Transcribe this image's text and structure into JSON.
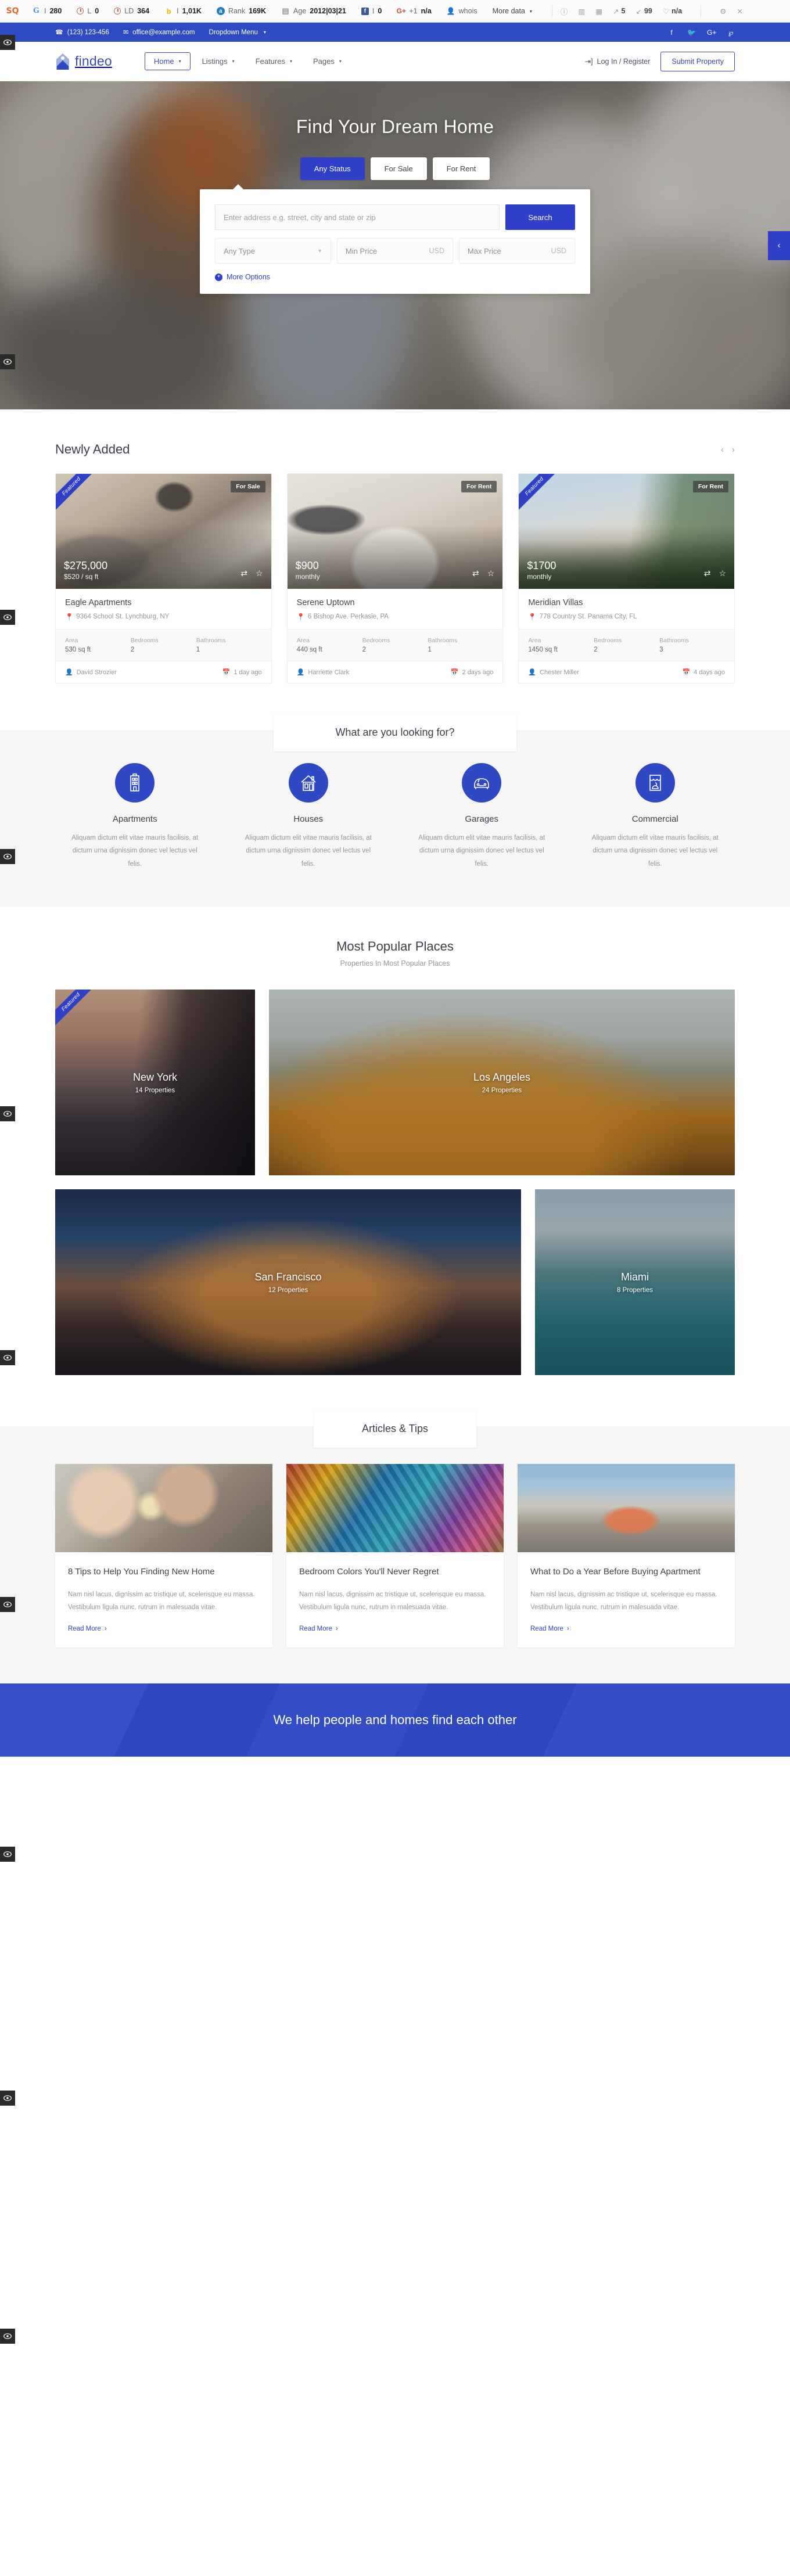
{
  "seo_toolbar": {
    "items": [
      {
        "icon": "seoquake-icon",
        "label": "",
        "value": ""
      },
      {
        "icon": "google-icon",
        "label": "I",
        "value": "280"
      },
      {
        "icon": "semrush-link-icon",
        "label": "L",
        "value": "0"
      },
      {
        "icon": "semrush-ld-icon",
        "label": "LD",
        "value": "364"
      },
      {
        "icon": "bing-icon",
        "label": "I",
        "value": "1,01K"
      },
      {
        "icon": "alexa-icon",
        "label": "Rank",
        "value": "169K"
      },
      {
        "icon": "age-icon",
        "label": "Age",
        "value": "2012|03|21"
      },
      {
        "icon": "facebook-icon",
        "label": "I",
        "value": "0"
      },
      {
        "icon": "google-plus-icon",
        "label": "+1",
        "value": "n/a"
      },
      {
        "icon": "whois-icon",
        "label": "whois",
        "value": ""
      }
    ],
    "more_data": "More data",
    "right_icons": [
      {
        "name": "info-icon",
        "value": ""
      },
      {
        "name": "keyword-density-icon",
        "value": ""
      },
      {
        "name": "diagnosis-icon",
        "value": ""
      },
      {
        "name": "external-links-icon",
        "value": "5"
      },
      {
        "name": "internal-links-icon",
        "value": "99"
      },
      {
        "name": "page-health-icon",
        "value": "n/a"
      },
      {
        "name": "settings-gear-icon",
        "value": ""
      },
      {
        "name": "close-icon",
        "value": ""
      }
    ]
  },
  "topbar": {
    "phone": "(123) 123-456",
    "email": "office@example.com",
    "dropdown": "Dropdown Menu",
    "socials": [
      "facebook-icon",
      "twitter-icon",
      "google-plus-icon",
      "pinterest-icon"
    ]
  },
  "header": {
    "brand": "findeo",
    "nav": [
      {
        "label": "Home",
        "active": true,
        "has_caret": true
      },
      {
        "label": "Listings",
        "active": false,
        "has_caret": true
      },
      {
        "label": "Features",
        "active": false,
        "has_caret": true
      },
      {
        "label": "Pages",
        "active": false,
        "has_caret": true
      }
    ],
    "login": "Log In / Register",
    "submit": "Submit Property"
  },
  "hero": {
    "title": "Find Your Dream Home",
    "status_tabs": [
      {
        "label": "Any Status",
        "active": true
      },
      {
        "label": "For Sale",
        "active": false
      },
      {
        "label": "For Rent",
        "active": false
      }
    ],
    "search_placeholder": "Enter address e.g. street, city and state or zip",
    "search_value": "",
    "search_button": "Search",
    "type_select": "Any Type",
    "min_price_placeholder": "Min Price",
    "min_price_unit": "USD",
    "max_price_placeholder": "Max Price",
    "max_price_unit": "USD",
    "more_options": "More Options",
    "next_arrow": "next-slide-arrow"
  },
  "newly_added": {
    "title": "Newly Added",
    "prev": "‹",
    "next": "›",
    "spec_labels": {
      "area": "Area",
      "bedrooms": "Bedrooms",
      "bathrooms": "Bathrooms"
    },
    "cards": [
      {
        "ribbon": "Featured",
        "status": "For Sale",
        "price": "$275,000",
        "price_sub": "$520 / sq ft",
        "title": "Eagle Apartments",
        "address": "9364 School St. Lynchburg, NY",
        "area": "530 sq ft",
        "bedrooms": "2",
        "bathrooms": "1",
        "agent": "David Strozier",
        "when": "1 day ago"
      },
      {
        "ribbon": "",
        "status": "For Rent",
        "price": "$900",
        "price_sub": "monthly",
        "title": "Serene Uptown",
        "address": "6 Bishop Ave. Perkasie, PA",
        "area": "440 sq ft",
        "bedrooms": "2",
        "bathrooms": "1",
        "agent": "Harriette Clark",
        "when": "2 days ago"
      },
      {
        "ribbon": "Featured",
        "status": "For Rent",
        "price": "$1700",
        "price_sub": "monthly",
        "title": "Meridian Villas",
        "address": "778 Country St. Panama City, FL",
        "area": "1450 sq ft",
        "bedrooms": "2",
        "bathrooms": "3",
        "agent": "Chester Miller",
        "when": "4 days ago"
      }
    ]
  },
  "looking_for": {
    "title": "What are you looking for?",
    "categories": [
      {
        "icon": "apartment-building-icon",
        "name": "Apartments",
        "desc": "Aliquam dictum elit vitae mauris facilisis, at dictum urna dignissim donec vel lectus vel felis."
      },
      {
        "icon": "house-icon",
        "name": "Houses",
        "desc": "Aliquam dictum elit vitae mauris facilisis, at dictum urna dignissim donec vel lectus vel felis."
      },
      {
        "icon": "car-icon",
        "name": "Garages",
        "desc": "Aliquam dictum elit vitae mauris facilisis, at dictum urna dignissim donec vel lectus vel felis."
      },
      {
        "icon": "storefront-icon",
        "name": "Commercial",
        "desc": "Aliquam dictum elit vitae mauris facilisis, at dictum urna dignissim donec vel lectus vel felis."
      }
    ]
  },
  "popular_places": {
    "title": "Most Popular Places",
    "subtitle": "Properties In Most Popular Places",
    "row1": [
      {
        "name": "New York",
        "count": "14 Properties",
        "ribbon": "Featured"
      },
      {
        "name": "Los Angeles",
        "count": "24 Properties",
        "ribbon": ""
      }
    ],
    "row2": [
      {
        "name": "San Francisco",
        "count": "12 Properties",
        "ribbon": ""
      },
      {
        "name": "Miami",
        "count": "8 Properties",
        "ribbon": ""
      }
    ]
  },
  "articles": {
    "title": "Articles & Tips",
    "read_more": "Read More",
    "items": [
      {
        "image": "father-daughter-sparkler-photo",
        "title": "8 Tips to Help You Finding New Home",
        "excerpt": "Nam nisl lacus, dignissim ac tristique ut, scelerisque eu massa. Vestibulum ligula nunc, rutrum in malesuada vitae."
      },
      {
        "image": "paint-brushes-photo",
        "title": "Bedroom Colors You'll Never Regret",
        "excerpt": "Nam nisl lacus, dignissim ac tristique ut, scelerisque eu massa. Vestibulum ligula nunc, rutrum in malesuada vitae."
      },
      {
        "image": "man-overlooking-city-photo",
        "title": "What to Do a Year Before Buying Apartment",
        "excerpt": "Nam nisl lacus, dignissim ac tristique ut, scelerisque eu massa. Vestibulum ligula nunc, rutrum in malesuada vitae."
      }
    ]
  },
  "cta": {
    "heading": "We help people and homes find each other"
  },
  "colors": {
    "brand_blue": "#2f3fc7",
    "topbar_blue": "#2f4bc4",
    "cta_blue": "#2f49c5",
    "text_dark": "#3a3f4a",
    "text_muted": "#9097a0",
    "page_grey": "#f6f6f6"
  }
}
